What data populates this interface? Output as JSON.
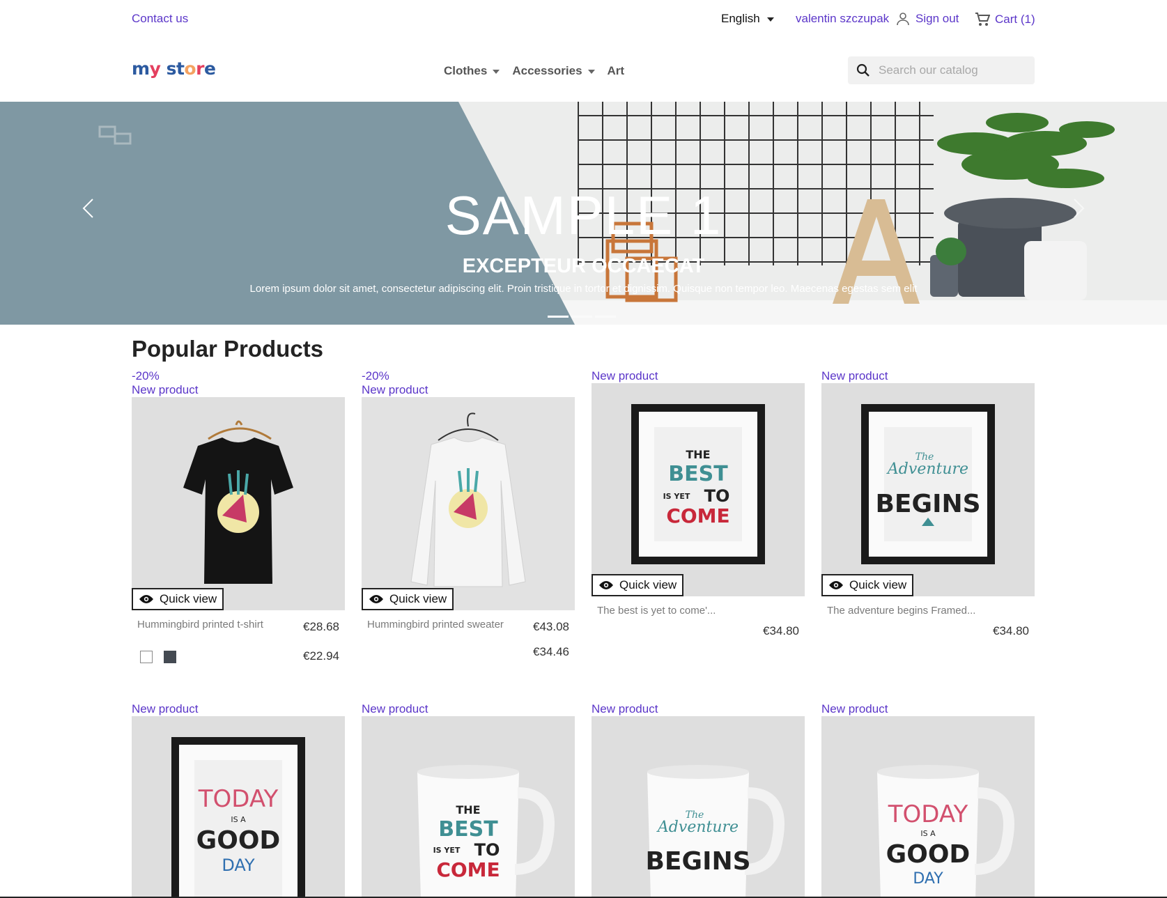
{
  "topbar": {
    "contact": "Contact us",
    "language": "English",
    "user_name": "valentin szczupak",
    "sign_out": "Sign out",
    "cart": "Cart (1)"
  },
  "header": {
    "logo": "my store",
    "nav": [
      "Clothes",
      "Accessories",
      "Art"
    ],
    "search_placeholder": "Search our catalog"
  },
  "hero": {
    "title": "SAMPLE 1",
    "subtitle": "EXCEPTEUR OCCAECAT",
    "text": "Lorem ipsum dolor sit amet, consectetur adipiscing elit. Proin tristique in tortor et dignissim. Quisque non tempor leo. Maecenas egestas sem elit",
    "slides": 3,
    "active_slide": 1
  },
  "section_title": "Popular Products",
  "quick_view_label": "Quick view",
  "products_row1": [
    {
      "discount": "-20%",
      "flag": "New product",
      "name": "Hummingbird printed t-shirt",
      "price_old": "€28.68",
      "price": "€22.94",
      "swatches": [
        "white",
        "dark"
      ]
    },
    {
      "discount": "-20%",
      "flag": "New product",
      "name": "Hummingbird printed sweater",
      "price_old": "€43.08",
      "price": "€34.46"
    },
    {
      "flag": "New product",
      "name": "The best is yet to come'...",
      "price": "€34.80"
    },
    {
      "flag": "New product",
      "name": "The adventure begins Framed...",
      "price": "€34.80"
    }
  ],
  "products_row2": [
    {
      "flag": "New product"
    },
    {
      "flag": "New product"
    },
    {
      "flag": "New product"
    },
    {
      "flag": "New product"
    }
  ],
  "artwork": {
    "best": [
      "THE",
      "BEST",
      "IS YET",
      "TO",
      "COME"
    ],
    "adventure": [
      "The",
      "Adventure",
      "BEGINS"
    ],
    "today": [
      "TODAY",
      "IS A",
      "GOOD",
      "DAY"
    ]
  },
  "colors": {
    "accent": "#5b36c9",
    "hero_panel": "#7f98a3",
    "thumb_bg": "#dedede"
  }
}
